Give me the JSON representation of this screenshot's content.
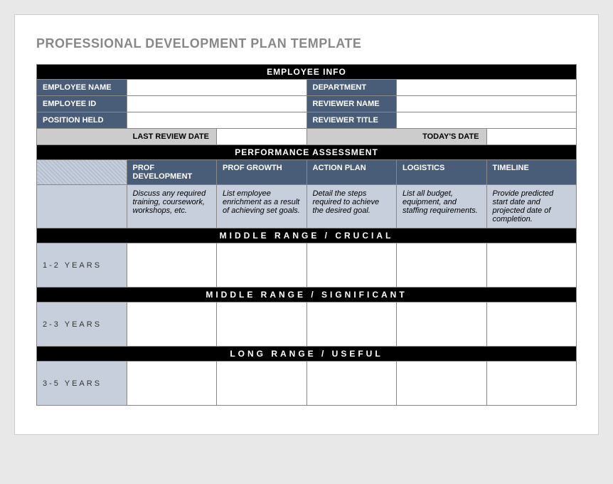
{
  "title": "PROFESSIONAL DEVELOPMENT PLAN TEMPLATE",
  "sections": {
    "employee_info": {
      "header": "EMPLOYEE INFO",
      "fields": {
        "employee_name": "EMPLOYEE NAME",
        "department": "DEPARTMENT",
        "employee_id": "EMPLOYEE ID",
        "reviewer_name": "REVIEWER NAME",
        "position_held": "POSITION HELD",
        "reviewer_title": "REVIEWER TITLE"
      },
      "dates": {
        "last_review": "LAST REVIEW DATE",
        "today": "TODAY'S DATE"
      }
    },
    "performance": {
      "header": "PERFORMANCE ASSESSMENT",
      "columns": {
        "dev": {
          "label": "PROF DEVELOPMENT",
          "desc": "Discuss any required training, coursework, workshops, etc."
        },
        "growth": {
          "label": "PROF GROWTH",
          "desc": "List employee enrichment as a result of achieving set goals."
        },
        "action": {
          "label": "ACTION PLAN",
          "desc": "Detail the steps required to achieve the desired goal."
        },
        "logistics": {
          "label": "LOGISTICS",
          "desc": "List all budget, equipment, and staffing requirements."
        },
        "timeline": {
          "label": "TIMELINE",
          "desc": "Provide predicted start date and projected date of completion."
        }
      },
      "ranges": {
        "r1": {
          "header": "MIDDLE RANGE  /  CRUCIAL",
          "label": "1-2 YEARS"
        },
        "r2": {
          "header": "MIDDLE RANGE  /  SIGNIFICANT",
          "label": "2-3 YEARS"
        },
        "r3": {
          "header": "LONG RANGE  /  USEFUL",
          "label": "3-5 YEARS"
        }
      }
    }
  }
}
